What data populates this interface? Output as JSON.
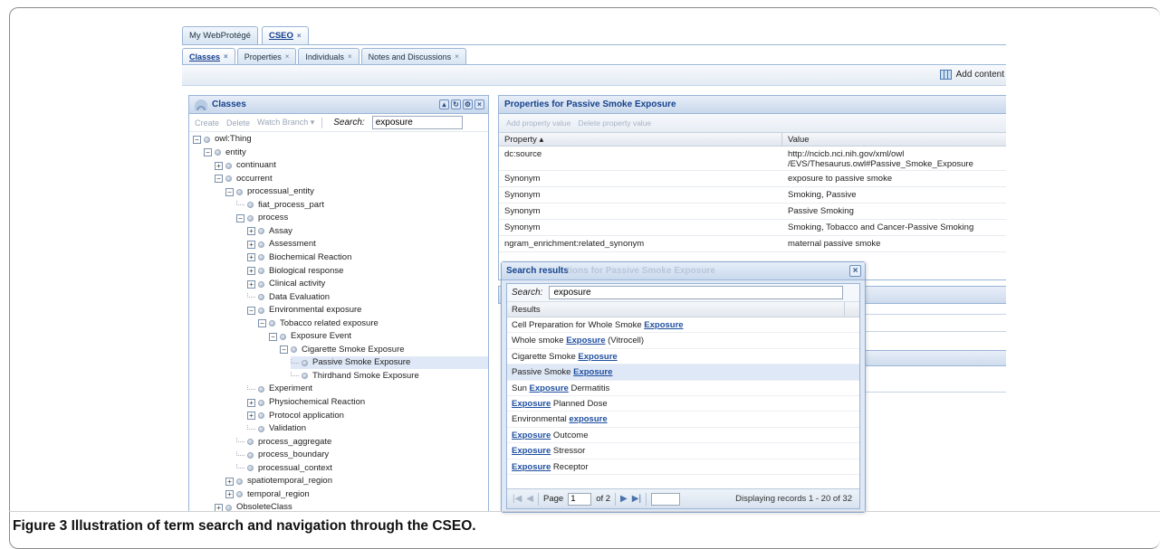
{
  "top_tabs": [
    {
      "label": "My WebProtégé",
      "closable": false,
      "active": false
    },
    {
      "label": "CSEO",
      "closable": true,
      "active": true
    }
  ],
  "sub_tabs": [
    {
      "label": "Classes",
      "active": true
    },
    {
      "label": "Properties",
      "active": false
    },
    {
      "label": "Individuals",
      "active": false
    },
    {
      "label": "Notes and Discussions",
      "active": false
    }
  ],
  "toolbar": {
    "add_content": "Add content",
    "add_content_icon": "grid-icon"
  },
  "classes_panel": {
    "title": "Classes",
    "icon": "peacock-icon",
    "tools": [
      "Create",
      "Delete",
      "Watch Branch ▾"
    ],
    "search_label": "Search:",
    "search_value": "exposure",
    "tree": [
      {
        "label": "owl:Thing",
        "depth": 0,
        "toggle": "minus"
      },
      {
        "label": "entity",
        "depth": 1,
        "toggle": "minus"
      },
      {
        "label": "continuant",
        "depth": 2,
        "toggle": "plus"
      },
      {
        "label": "occurrent",
        "depth": 2,
        "toggle": "minus"
      },
      {
        "label": "processual_entity",
        "depth": 3,
        "toggle": "minus"
      },
      {
        "label": "fiat_process_part",
        "depth": 4,
        "toggle": "leaf"
      },
      {
        "label": "process",
        "depth": 4,
        "toggle": "minus"
      },
      {
        "label": "Assay",
        "depth": 5,
        "toggle": "plus"
      },
      {
        "label": "Assessment",
        "depth": 5,
        "toggle": "plus"
      },
      {
        "label": "Biochemical Reaction",
        "depth": 5,
        "toggle": "plus"
      },
      {
        "label": "Biological response",
        "depth": 5,
        "toggle": "plus"
      },
      {
        "label": "Clinical activity",
        "depth": 5,
        "toggle": "plus"
      },
      {
        "label": "Data Evaluation",
        "depth": 5,
        "toggle": "leaf"
      },
      {
        "label": "Environmental exposure",
        "depth": 5,
        "toggle": "minus"
      },
      {
        "label": "Tobacco related exposure",
        "depth": 6,
        "toggle": "minus"
      },
      {
        "label": "Exposure Event",
        "depth": 7,
        "toggle": "minus"
      },
      {
        "label": "Cigarette Smoke Exposure",
        "depth": 8,
        "toggle": "minus"
      },
      {
        "label": "Passive Smoke Exposure",
        "depth": 9,
        "toggle": "leaf",
        "selected": true
      },
      {
        "label": "Thirdhand Smoke Exposure",
        "depth": 9,
        "toggle": "leaf"
      },
      {
        "label": "Experiment",
        "depth": 5,
        "toggle": "leaf"
      },
      {
        "label": "Physiochemical Reaction",
        "depth": 5,
        "toggle": "plus"
      },
      {
        "label": "Protocol application",
        "depth": 5,
        "toggle": "plus"
      },
      {
        "label": "Validation",
        "depth": 5,
        "toggle": "leaf"
      },
      {
        "label": "process_aggregate",
        "depth": 4,
        "toggle": "leaf"
      },
      {
        "label": "process_boundary",
        "depth": 4,
        "toggle": "leaf"
      },
      {
        "label": "processual_context",
        "depth": 4,
        "toggle": "leaf"
      },
      {
        "label": "spatiotemporal_region",
        "depth": 3,
        "toggle": "plus"
      },
      {
        "label": "temporal_region",
        "depth": 3,
        "toggle": "plus"
      },
      {
        "label": "ObsoleteClass",
        "depth": 2,
        "toggle": "plus"
      }
    ]
  },
  "properties_panel": {
    "title": "Properties for Passive Smoke Exposure",
    "tools": [
      "Add property value",
      "Delete property value"
    ],
    "col_property": "Property ▴",
    "col_value": "Value",
    "rows": [
      {
        "property": "dc:source",
        "value": "http://ncicb.nci.nih.gov/xml/owl /EVS/Thesaurus.owl#Passive_Smoke_Exposure"
      },
      {
        "property": "Synonym",
        "value": "exposure to passive smoke"
      },
      {
        "property": "Synonym",
        "value": "Smoking, Passive"
      },
      {
        "property": "Synonym",
        "value": "Passive Smoking"
      },
      {
        "property": "Synonym",
        "value": "Smoking, Tobacco and Cancer-Passive Smoking"
      },
      {
        "property": "ngram_enrichment:related_synonym",
        "value": "maternal passive smoke"
      }
    ]
  },
  "search_dialog": {
    "title": "Search results",
    "ghost_title": "tions for Passive Smoke Exposure",
    "search_label": "Search:",
    "search_value": "exposure",
    "results_header": "Results",
    "results": [
      {
        "before": "Cell Preparation for Whole Smoke ",
        "match": "Exposure",
        "after": ""
      },
      {
        "before": "Whole smoke ",
        "match": "Exposure",
        "after": " (Vitrocell)"
      },
      {
        "before": "Cigarette Smoke ",
        "match": "Exposure",
        "after": ""
      },
      {
        "before": "Passive Smoke ",
        "match": "Exposure",
        "after": "",
        "selected": true
      },
      {
        "before": "Sun ",
        "match": "Exposure",
        "after": " Dermatitis"
      },
      {
        "before": "",
        "match": "Exposure",
        "after": " Planned Dose"
      },
      {
        "before": "Environmental ",
        "match": "exposure",
        "after": ""
      },
      {
        "before": "",
        "match": "Exposure",
        "after": " Outcome"
      },
      {
        "before": "",
        "match": "Exposure",
        "after": " Stressor"
      },
      {
        "before": "",
        "match": "Exposure",
        "after": " Receptor"
      }
    ],
    "pager": {
      "page_label": "Page",
      "page_value": "1",
      "of_label": "of 2",
      "display": "Displaying records 1 - 20 of 32"
    }
  },
  "caption": {
    "label": "Figure 3",
    "text": " Illustration of term search and navigation through the CSEO."
  }
}
